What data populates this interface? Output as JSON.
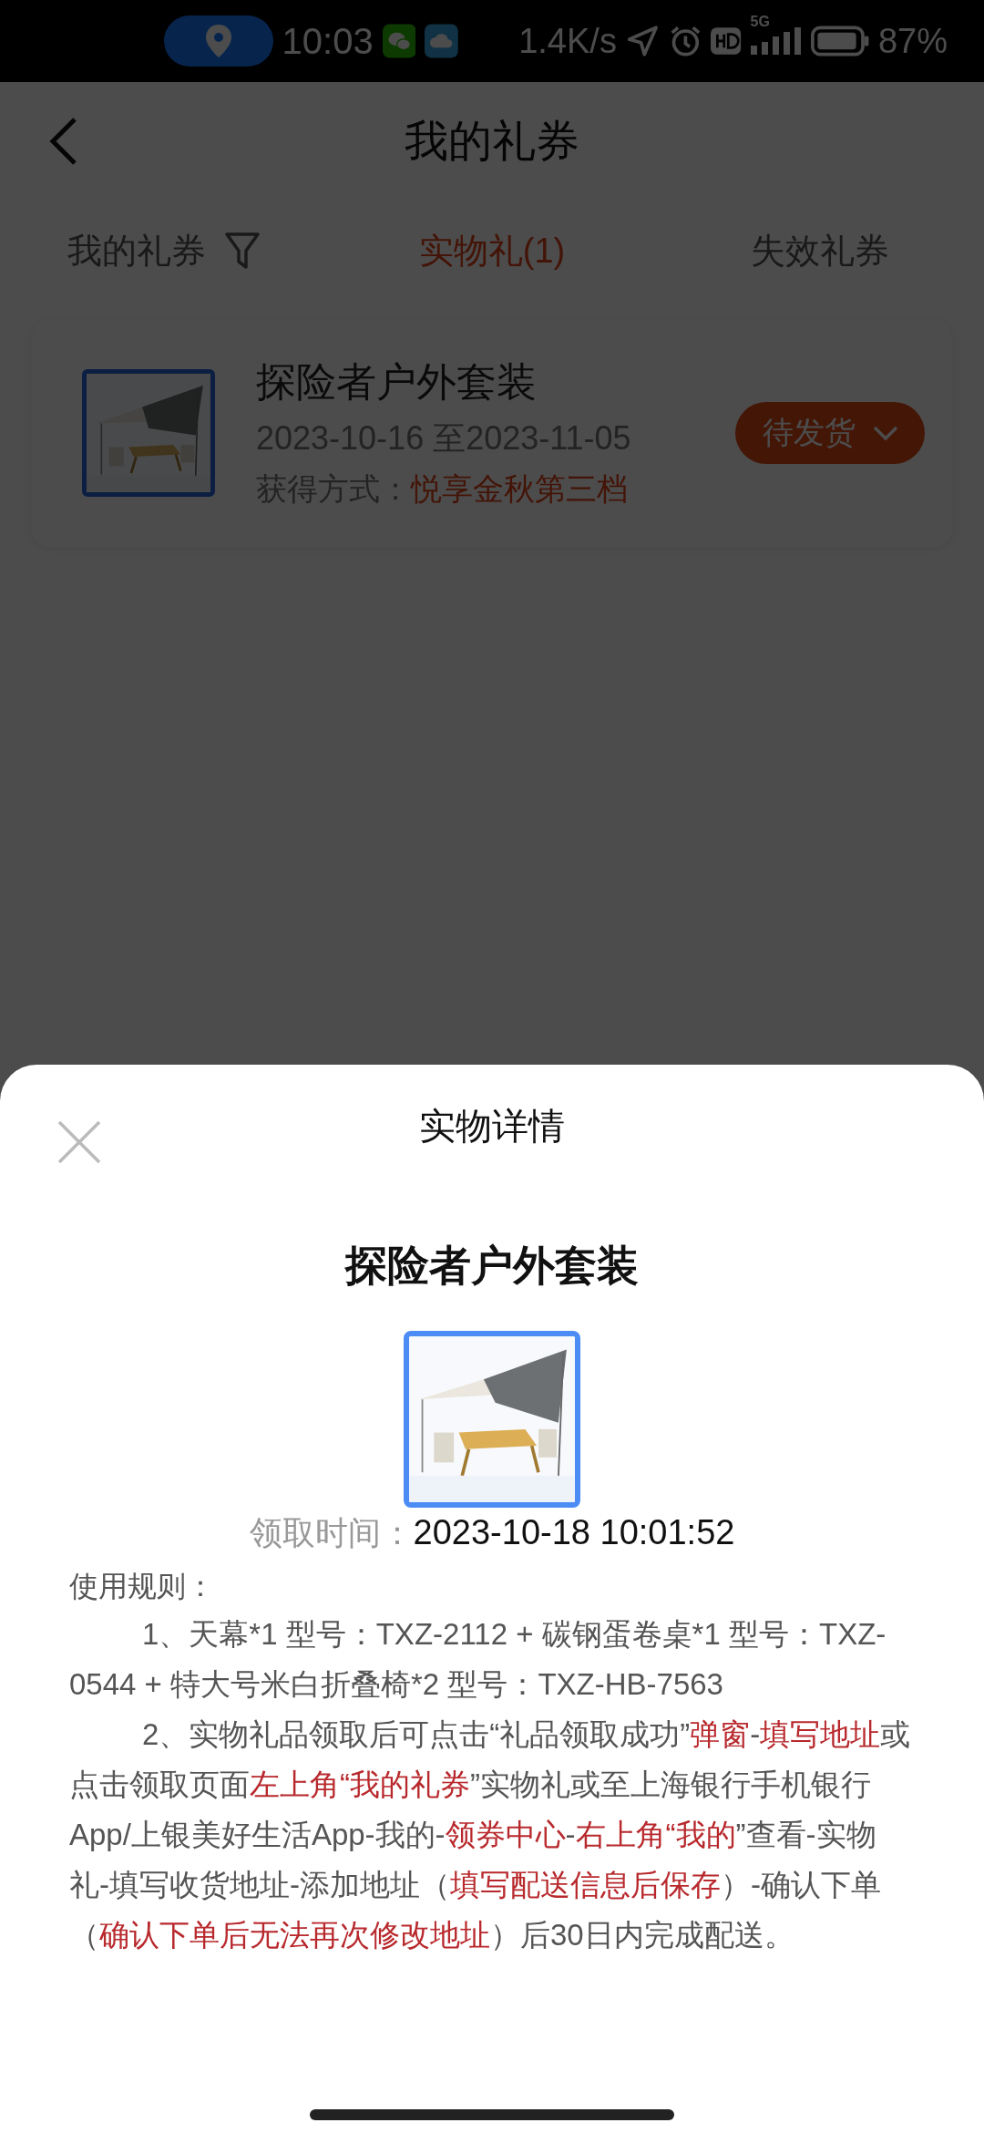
{
  "status_bar": {
    "time": "10:03",
    "net_speed": "1.4K/s",
    "network": "5G",
    "battery": "87%"
  },
  "header": {
    "title": "我的礼券"
  },
  "tabs": [
    {
      "label": "我的礼券",
      "selected": false,
      "filter": true
    },
    {
      "label": "实物礼(1)",
      "selected": true,
      "filter": false
    },
    {
      "label": "失效礼券",
      "selected": false,
      "filter": false
    }
  ],
  "gifts": [
    {
      "name": "探险者户外套装",
      "period": "2023-10-16 至2023-11-05",
      "source_label": "获得方式：",
      "source": "悦享金秋第三档",
      "status": "待发货"
    }
  ],
  "sheet": {
    "title": "实物详情",
    "item_name": "探险者户外套装",
    "claim_label": "领取时间：",
    "claim_time": "2023-10-18 10:01:52",
    "rules_title": "使用规则：",
    "rules": [
      [
        {
          "text": "1、天幕*1 型号：TXZ-2112 + 碳钢蛋卷桌*1 型号：TXZ-0544 + 特大号米白折叠椅*2 型号：TXZ-HB-7563",
          "highlight": false
        }
      ],
      [
        {
          "text": "2、实物礼品领取后可点击“礼品领取成功”",
          "highlight": false
        },
        {
          "text": "弹窗",
          "highlight": true
        },
        {
          "text": "-",
          "highlight": false
        },
        {
          "text": "填写地址",
          "highlight": true
        },
        {
          "text": "或点击领取页面",
          "highlight": false
        },
        {
          "text": "左上角“我的礼券",
          "highlight": true
        },
        {
          "text": "”实物礼或至上海银行手机银行App/上银美好生活App-我的-",
          "highlight": false
        },
        {
          "text": "领券中心",
          "highlight": true
        },
        {
          "text": "-",
          "highlight": false
        },
        {
          "text": "右上角“我的",
          "highlight": true
        },
        {
          "text": "”查看-实物礼-填写收货地址-添加地址（",
          "highlight": false
        },
        {
          "text": "填写配送信息后保存",
          "highlight": true
        },
        {
          "text": "）-确认下单（",
          "highlight": false
        },
        {
          "text": "确认下单后无法再次修改地址",
          "highlight": true
        },
        {
          "text": "）后30日内完成配送。",
          "highlight": false
        }
      ]
    ]
  }
}
